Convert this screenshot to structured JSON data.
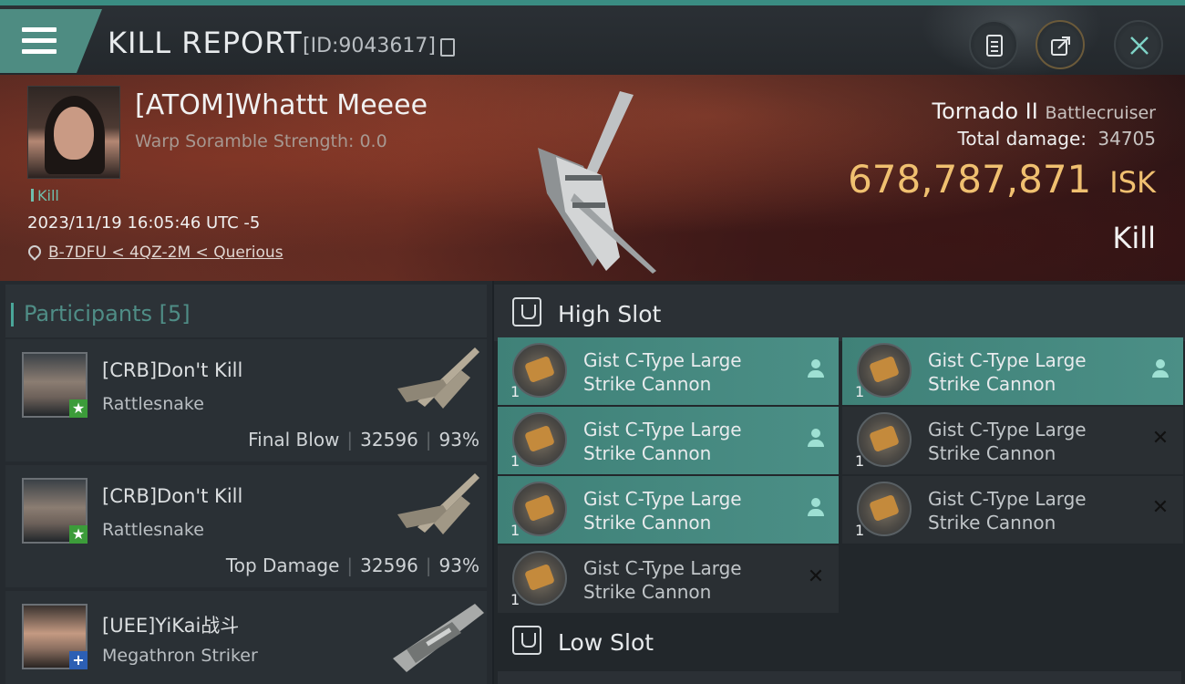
{
  "header": {
    "title": "KILL REPORT",
    "report_id": "[ID:9043617]"
  },
  "victim": {
    "name": "[ATOM]Whattt Meeee",
    "scramble": "Warp Soramble Strength: 0.0",
    "tag": "Kill",
    "timestamp": "2023/11/19 16:05:46 UTC -5",
    "location": "B-7DFU < 4QZ-2M < Querious",
    "ship_name": "Tornado II",
    "ship_class": "Battlecruiser",
    "total_damage_label": "Total damage:",
    "total_damage": "34705",
    "isk_value": "678,787,871",
    "isk_unit": "ISK",
    "result": "Kill"
  },
  "participants": {
    "title": "Participants",
    "count": "[5]",
    "rows": [
      {
        "name": "[CRB]Don't Kill",
        "ship": "Rattlesnake",
        "role": "Final Blow",
        "damage": "32596",
        "percent": "93%",
        "badge": "★"
      },
      {
        "name": "[CRB]Don't Kill",
        "ship": "Rattlesnake",
        "role": "Top Damage",
        "damage": "32596",
        "percent": "93%",
        "badge": "★"
      },
      {
        "name": "[UEE]YiKai战斗",
        "ship": "Megathron Striker",
        "badge": "+"
      }
    ]
  },
  "slots": {
    "high_title": "High Slot",
    "low_title": "Low Slot",
    "modules": [
      {
        "line1": "Gist C-Type Large",
        "line2": "Strike Cannon",
        "qty": "1",
        "status": "pilot-icon"
      },
      {
        "line1": "Gist C-Type Large",
        "line2": "Strike Cannon",
        "qty": "1",
        "status": "pilot-icon"
      },
      {
        "line1": "Gist C-Type Large",
        "line2": "Strike Cannon",
        "qty": "1",
        "status": "pilot-icon"
      },
      {
        "line1": "Gist C-Type Large",
        "line2": "Strike Cannon",
        "qty": "1",
        "status": "x-icon"
      },
      {
        "line1": "Gist C-Type Large",
        "line2": "Strike Cannon",
        "qty": "1",
        "status": "pilot-icon"
      },
      {
        "line1": "Gist C-Type Large",
        "line2": "Strike Cannon",
        "qty": "1",
        "status": "x-icon"
      },
      {
        "line1": "Gist C-Type Large",
        "line2": "Strike Cannon",
        "qty": "1",
        "status": "x-icon"
      }
    ]
  },
  "icons": {
    "menu": "menu-icon",
    "copy": "copy-icon",
    "clipboard": "clipboard-icon",
    "share": "share-icon",
    "close": "close-icon",
    "location": "location-pin-icon"
  },
  "colors": {
    "accent": "#4e8c82",
    "isk": "#f0c070",
    "module_active": "#4b8f86"
  }
}
